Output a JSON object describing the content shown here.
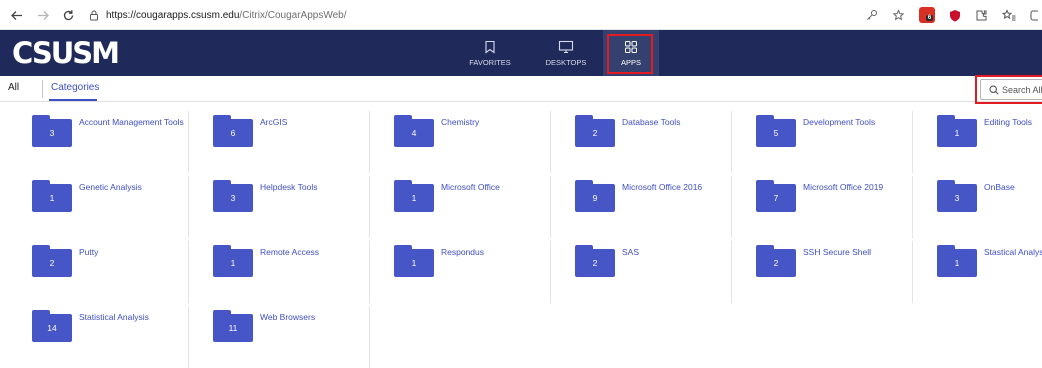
{
  "browser": {
    "url_host": "https://cougarapps.csusm.edu",
    "url_path": "/Citrix/CougarAppsWeb/",
    "back_icon": "arrow-left-icon",
    "forward_icon": "arrow-right-icon",
    "reload_icon": "reload-icon"
  },
  "header": {
    "logo": "CSUSM",
    "nav": [
      {
        "label": "FAVORITES",
        "icon": "bookmark-icon"
      },
      {
        "label": "DESKTOPS",
        "icon": "monitor-icon"
      },
      {
        "label": "APPS",
        "icon": "grid-icon"
      }
    ]
  },
  "tabs": {
    "all": "All",
    "categories": "Categories"
  },
  "search": {
    "placeholder": "Search All Apps"
  },
  "categories": [
    {
      "name": "Account Management Tools",
      "count": "3"
    },
    {
      "name": "ArcGIS",
      "count": "6"
    },
    {
      "name": "Chemistry",
      "count": "4"
    },
    {
      "name": "Database Tools",
      "count": "2"
    },
    {
      "name": "Development Tools",
      "count": "5"
    },
    {
      "name": "Editing Tools",
      "count": "1"
    },
    {
      "name": "Genetic Analysis",
      "count": "1"
    },
    {
      "name": "Helpdesk Tools",
      "count": "3"
    },
    {
      "name": "Microsoft Office",
      "count": "1"
    },
    {
      "name": "Microsoft Office 2016",
      "count": "9"
    },
    {
      "name": "Microsoft Office 2019",
      "count": "7"
    },
    {
      "name": "OnBase",
      "count": "3"
    },
    {
      "name": "Putty",
      "count": "2"
    },
    {
      "name": "Remote Access",
      "count": "1"
    },
    {
      "name": "Respondus",
      "count": "1"
    },
    {
      "name": "SAS",
      "count": "2"
    },
    {
      "name": "SSH Secure Shell",
      "count": "2"
    },
    {
      "name": "Stastical Analysis",
      "count": "1"
    },
    {
      "name": "Statistical Analysis",
      "count": "14"
    },
    {
      "name": "Web Browsers",
      "count": "11"
    }
  ],
  "colors": {
    "header_bg": "#1f2a5a",
    "accent": "#3f4fc4",
    "folder": "#4656c7",
    "highlight": "#e21b23"
  }
}
